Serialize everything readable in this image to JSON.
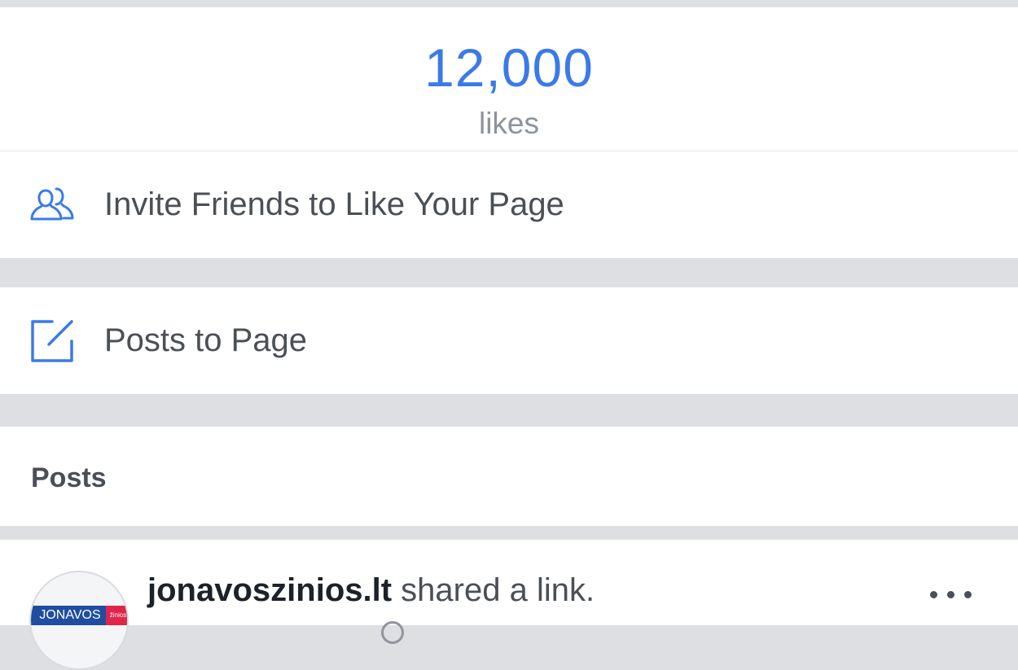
{
  "likes": {
    "count": "12,000",
    "label": "likes"
  },
  "actions": {
    "invite_label": "Invite Friends to Like Your Page",
    "posts_to_page_label": "Posts to Page"
  },
  "posts_section": {
    "header": "Posts"
  },
  "post": {
    "author": "jonavoszinios.lt",
    "action_text": " shared a link.",
    "avatar_text": "JONAVOS",
    "avatar_tag": "žinios",
    "more_icon": "more-dots-icon"
  },
  "colors": {
    "accent": "#3b7ae8",
    "text": "#4b4f56",
    "muted": "#8d939b",
    "separator": "#dddfe3"
  }
}
